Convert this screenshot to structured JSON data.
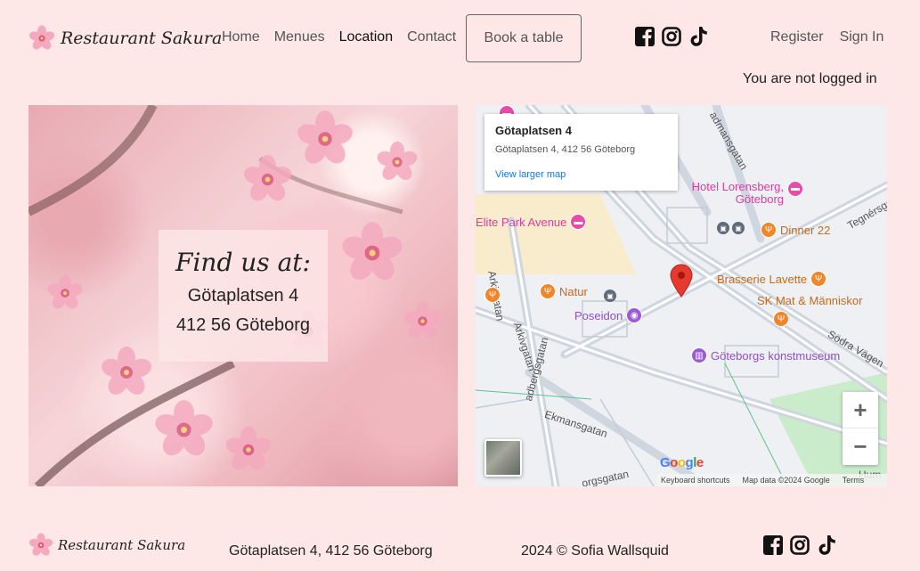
{
  "header": {
    "brand": "Restaurant Sakura",
    "nav": [
      {
        "label": "Home",
        "active": false
      },
      {
        "label": "Menues",
        "active": false
      },
      {
        "label": "Location",
        "active": true
      },
      {
        "label": "Contact",
        "active": false
      }
    ],
    "book_label": "Book a table",
    "social": [
      "facebook-icon",
      "instagram-icon",
      "tiktok-icon"
    ],
    "register_label": "Register",
    "signin_label": "Sign In",
    "login_status": "You are not logged in"
  },
  "hero": {
    "title": "Find us at:",
    "line1": "Götaplatsen 4",
    "line2": "412 56 Göteborg"
  },
  "map": {
    "place_name": "Götaplatsen 4",
    "place_address": "Götaplatsen 4, 412 56 Göteborg",
    "larger_map_link": "View larger map",
    "pois": {
      "hotel_lorensberg": "Hotel Lorensberg, Göteborg",
      "elite_park": "Elite Park Avenue",
      "dinner22": "Dinner 22",
      "brasserie": "Brasserie Lavette",
      "sk_mat": "SK Mat & Människor",
      "natur": "Natur",
      "poseidon": "Poseidon",
      "konstmuseum": "Göteborgs konstmuseum"
    },
    "streets": {
      "s1": "Arkivgatan",
      "s2": "Arkivgatan",
      "s3": "Ekmansgatan",
      "s4": "adbergsgatan",
      "s5": "Södra Vägen",
      "s6": "Tegnérsgatan",
      "s7": "admansgatan",
      "s8": "orgsgatan",
      "s9": "Hum"
    },
    "attribution": {
      "shortcuts": "Keyboard shortcuts",
      "data": "Map data ©2024 Google",
      "terms": "Terms"
    },
    "google_logo": "Google"
  },
  "footer": {
    "brand": "Restaurant Sakura",
    "address": "Götaplatsen 4, 412 56 Göteborg",
    "copyright": "2024 © Sofia Wallsquid"
  },
  "colors": {
    "background": "#fde7e7",
    "poi_pink": "#e94ba8",
    "poi_orange": "#f0862a",
    "poi_purple": "#9b5bd6",
    "link_blue": "#1a73e8"
  }
}
